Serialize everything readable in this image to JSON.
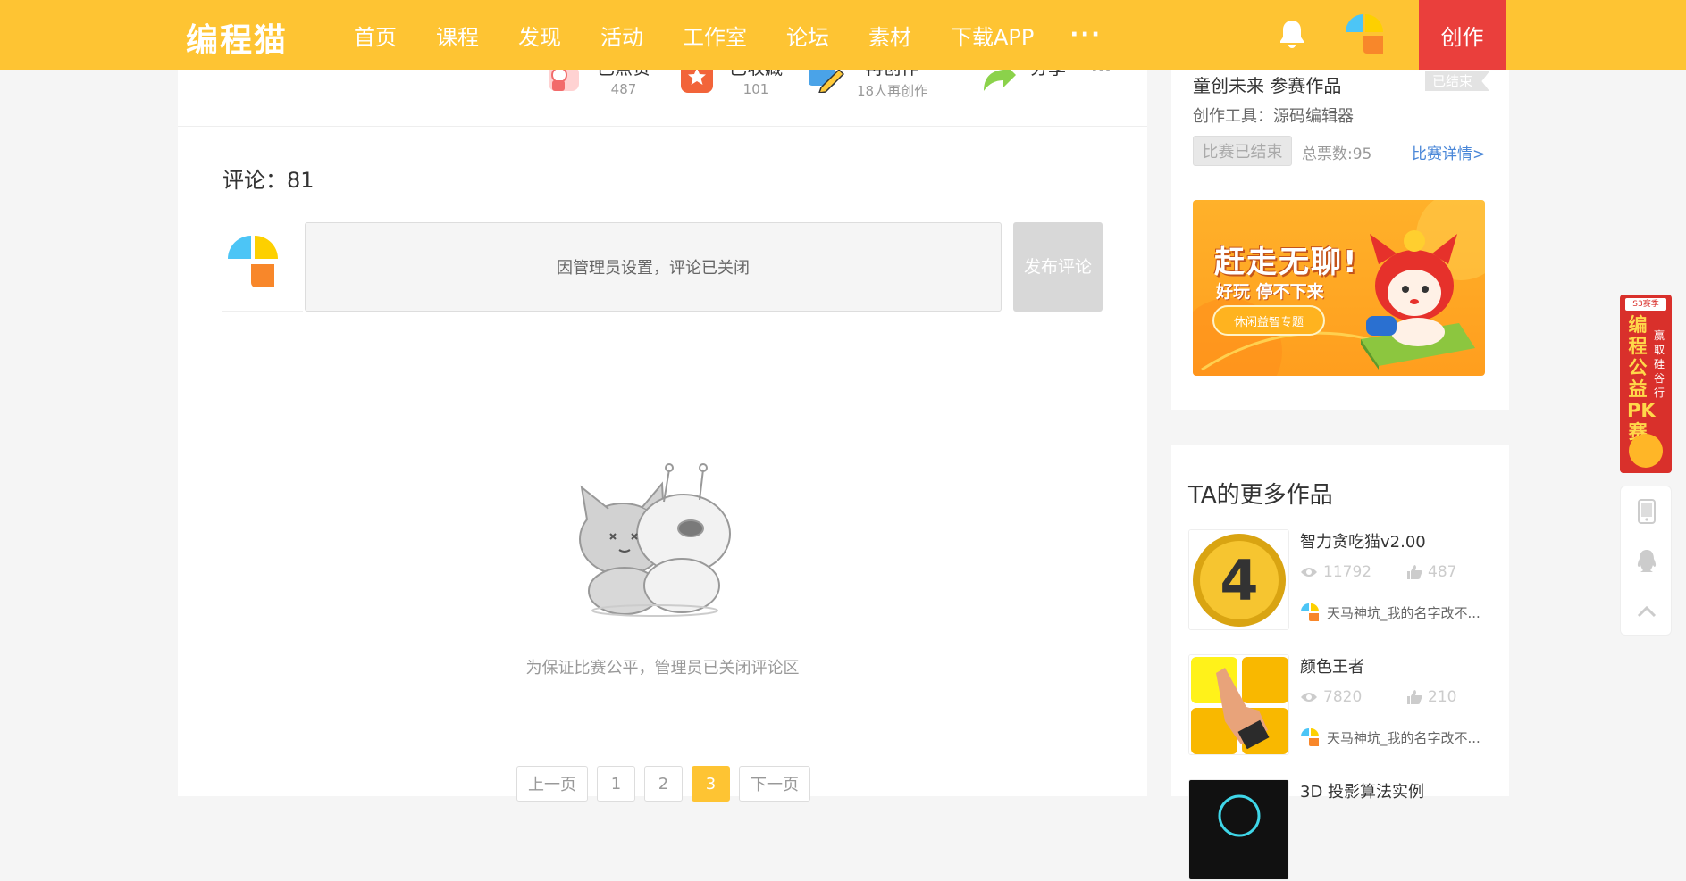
{
  "header": {
    "logo": "编程猫",
    "nav": [
      "首页",
      "课程",
      "发现",
      "活动",
      "工作室",
      "论坛",
      "素材",
      "下载APP"
    ],
    "more": "···",
    "create": "创作"
  },
  "actions": [
    {
      "label": "已点赞",
      "count": "487"
    },
    {
      "label": "已收藏",
      "count": "101"
    },
    {
      "label": "再创作",
      "count": "18人再创作"
    },
    {
      "label": "分享",
      "count": ""
    }
  ],
  "actions_more": "···",
  "comments": {
    "title": "评论：81",
    "box_text": "因管理员设置，评论已关闭",
    "publish": "发布评论",
    "empty_text": "为保证比赛公平，管理员已关闭评论区"
  },
  "pager": {
    "prev": "上一页",
    "pages": [
      "1",
      "2",
      "3"
    ],
    "current": "3",
    "next": "下一页"
  },
  "contest": {
    "name": "童创未来 参赛作品",
    "ended_flag": "已结束",
    "tool": "创作工具：源码编辑器",
    "end_badge": "比赛已结束",
    "votes": "总票数:95",
    "link": "比赛详情>"
  },
  "banner": {
    "title": "赶走无聊!",
    "sub": "好玩 停不下来",
    "pill": "休闲益智专题"
  },
  "more_works": {
    "title": "TA的更多作品",
    "items": [
      {
        "name": "智力贪吃猫v2.00",
        "views": "11792",
        "likes": "487",
        "author": "天马神坑_我的名字改不..."
      },
      {
        "name": "颜色王者",
        "views": "7820",
        "likes": "210",
        "author": "天马神坑_我的名字改不..."
      },
      {
        "name": "3D 投影算法实例",
        "views": "",
        "likes": "",
        "author": ""
      }
    ]
  },
  "promo": {
    "tag": "S3赛季",
    "main": "编程公益PK赛",
    "side": "赢取硅谷行"
  },
  "colors": {
    "brand": "#fec433",
    "create": "#ea3f3c",
    "link": "#4a87d8"
  }
}
